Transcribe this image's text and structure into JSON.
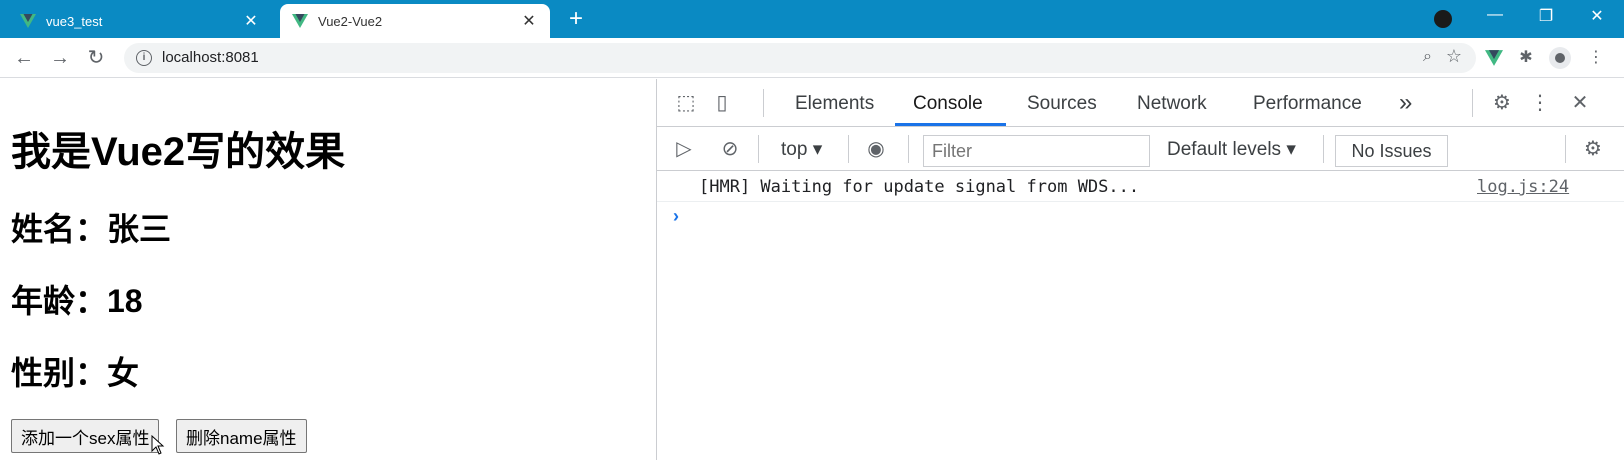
{
  "browser": {
    "tabs": [
      {
        "title": "vue3_test",
        "active": false
      },
      {
        "title": "Vue2-Vue2",
        "active": true
      }
    ],
    "new_tab": "+",
    "address": "localhost:8081",
    "window_controls": [
      "—",
      "❐",
      "✕"
    ]
  },
  "page": {
    "heading": "我是Vue2写的效果",
    "name_line": "姓名：张三",
    "age_line": "年龄：18",
    "sex_line": "性别：女",
    "buttons": [
      "添加一个sex属性",
      "删除name属性"
    ]
  },
  "devtools": {
    "tabs": [
      "Elements",
      "Console",
      "Sources",
      "Network",
      "Performance"
    ],
    "more": "»",
    "active_tab": "Console",
    "context": "top",
    "filter_placeholder": "Filter",
    "levels": "Default levels",
    "issues": "No Issues",
    "log": {
      "message": "[HMR] Waiting for update signal from WDS...",
      "source": "log.js:24"
    },
    "prompt": "›"
  },
  "colors": {
    "titlebar": "#0a8ac3",
    "vue_green": "#41b883",
    "vue_dark": "#35495e",
    "accent": "#1a73e8"
  }
}
